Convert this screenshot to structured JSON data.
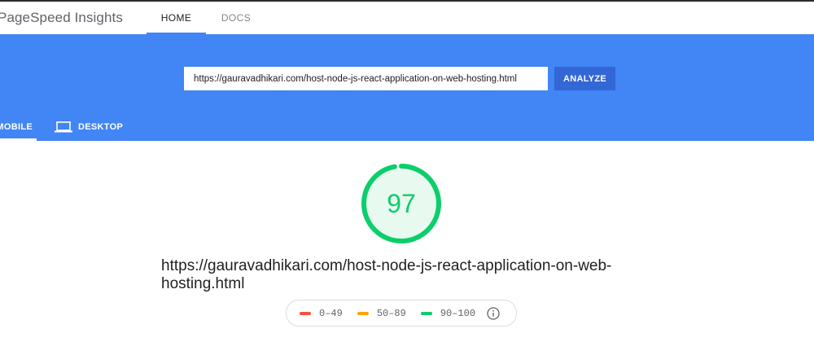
{
  "header": {
    "brand": "PageSpeed Insights",
    "nav": [
      {
        "label": "HOME"
      },
      {
        "label": "DOCS"
      }
    ]
  },
  "hero": {
    "url_value": "https://gauravadhikari.com/host-node-js-react-application-on-web-hosting.html",
    "analyze_label": "ANALYZE",
    "tabs": [
      {
        "label": "MOBILE",
        "icon": "mobile-icon"
      },
      {
        "label": "DESKTOP",
        "icon": "laptop-icon"
      }
    ]
  },
  "result": {
    "score": "97",
    "score_fraction": 0.97,
    "url": "https://gauravadhikari.com/host-node-js-react-application-on-web-hosting.html"
  },
  "legend": {
    "items": [
      {
        "range": "0–49",
        "color": "#ff4e42"
      },
      {
        "range": "50–89",
        "color": "#ffa400"
      },
      {
        "range": "90–100",
        "color": "#0cce6b"
      }
    ],
    "info_icon": "info-icon"
  },
  "colors": {
    "brand_blue": "#4285f4",
    "button_blue": "#3367d6",
    "pass_green": "#0cce6b",
    "pass_bg": "#e8f9ef"
  }
}
